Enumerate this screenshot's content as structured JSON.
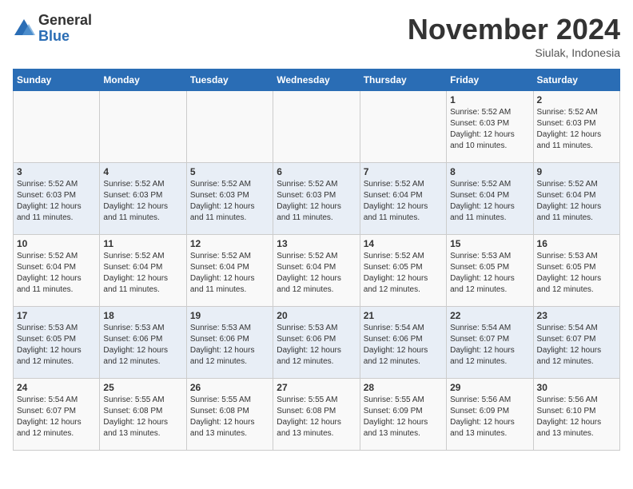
{
  "logo": {
    "general": "General",
    "blue": "Blue"
  },
  "header": {
    "month": "November 2024",
    "location": "Siulak, Indonesia"
  },
  "days_of_week": [
    "Sunday",
    "Monday",
    "Tuesday",
    "Wednesday",
    "Thursday",
    "Friday",
    "Saturday"
  ],
  "weeks": [
    [
      {
        "day": "",
        "info": ""
      },
      {
        "day": "",
        "info": ""
      },
      {
        "day": "",
        "info": ""
      },
      {
        "day": "",
        "info": ""
      },
      {
        "day": "",
        "info": ""
      },
      {
        "day": "1",
        "info": "Sunrise: 5:52 AM\nSunset: 6:03 PM\nDaylight: 12 hours\nand 10 minutes."
      },
      {
        "day": "2",
        "info": "Sunrise: 5:52 AM\nSunset: 6:03 PM\nDaylight: 12 hours\nand 11 minutes."
      }
    ],
    [
      {
        "day": "3",
        "info": "Sunrise: 5:52 AM\nSunset: 6:03 PM\nDaylight: 12 hours\nand 11 minutes."
      },
      {
        "day": "4",
        "info": "Sunrise: 5:52 AM\nSunset: 6:03 PM\nDaylight: 12 hours\nand 11 minutes."
      },
      {
        "day": "5",
        "info": "Sunrise: 5:52 AM\nSunset: 6:03 PM\nDaylight: 12 hours\nand 11 minutes."
      },
      {
        "day": "6",
        "info": "Sunrise: 5:52 AM\nSunset: 6:03 PM\nDaylight: 12 hours\nand 11 minutes."
      },
      {
        "day": "7",
        "info": "Sunrise: 5:52 AM\nSunset: 6:04 PM\nDaylight: 12 hours\nand 11 minutes."
      },
      {
        "day": "8",
        "info": "Sunrise: 5:52 AM\nSunset: 6:04 PM\nDaylight: 12 hours\nand 11 minutes."
      },
      {
        "day": "9",
        "info": "Sunrise: 5:52 AM\nSunset: 6:04 PM\nDaylight: 12 hours\nand 11 minutes."
      }
    ],
    [
      {
        "day": "10",
        "info": "Sunrise: 5:52 AM\nSunset: 6:04 PM\nDaylight: 12 hours\nand 11 minutes."
      },
      {
        "day": "11",
        "info": "Sunrise: 5:52 AM\nSunset: 6:04 PM\nDaylight: 12 hours\nand 11 minutes."
      },
      {
        "day": "12",
        "info": "Sunrise: 5:52 AM\nSunset: 6:04 PM\nDaylight: 12 hours\nand 11 minutes."
      },
      {
        "day": "13",
        "info": "Sunrise: 5:52 AM\nSunset: 6:04 PM\nDaylight: 12 hours\nand 12 minutes."
      },
      {
        "day": "14",
        "info": "Sunrise: 5:52 AM\nSunset: 6:05 PM\nDaylight: 12 hours\nand 12 minutes."
      },
      {
        "day": "15",
        "info": "Sunrise: 5:53 AM\nSunset: 6:05 PM\nDaylight: 12 hours\nand 12 minutes."
      },
      {
        "day": "16",
        "info": "Sunrise: 5:53 AM\nSunset: 6:05 PM\nDaylight: 12 hours\nand 12 minutes."
      }
    ],
    [
      {
        "day": "17",
        "info": "Sunrise: 5:53 AM\nSunset: 6:05 PM\nDaylight: 12 hours\nand 12 minutes."
      },
      {
        "day": "18",
        "info": "Sunrise: 5:53 AM\nSunset: 6:06 PM\nDaylight: 12 hours\nand 12 minutes."
      },
      {
        "day": "19",
        "info": "Sunrise: 5:53 AM\nSunset: 6:06 PM\nDaylight: 12 hours\nand 12 minutes."
      },
      {
        "day": "20",
        "info": "Sunrise: 5:53 AM\nSunset: 6:06 PM\nDaylight: 12 hours\nand 12 minutes."
      },
      {
        "day": "21",
        "info": "Sunrise: 5:54 AM\nSunset: 6:06 PM\nDaylight: 12 hours\nand 12 minutes."
      },
      {
        "day": "22",
        "info": "Sunrise: 5:54 AM\nSunset: 6:07 PM\nDaylight: 12 hours\nand 12 minutes."
      },
      {
        "day": "23",
        "info": "Sunrise: 5:54 AM\nSunset: 6:07 PM\nDaylight: 12 hours\nand 12 minutes."
      }
    ],
    [
      {
        "day": "24",
        "info": "Sunrise: 5:54 AM\nSunset: 6:07 PM\nDaylight: 12 hours\nand 12 minutes."
      },
      {
        "day": "25",
        "info": "Sunrise: 5:55 AM\nSunset: 6:08 PM\nDaylight: 12 hours\nand 13 minutes."
      },
      {
        "day": "26",
        "info": "Sunrise: 5:55 AM\nSunset: 6:08 PM\nDaylight: 12 hours\nand 13 minutes."
      },
      {
        "day": "27",
        "info": "Sunrise: 5:55 AM\nSunset: 6:08 PM\nDaylight: 12 hours\nand 13 minutes."
      },
      {
        "day": "28",
        "info": "Sunrise: 5:55 AM\nSunset: 6:09 PM\nDaylight: 12 hours\nand 13 minutes."
      },
      {
        "day": "29",
        "info": "Sunrise: 5:56 AM\nSunset: 6:09 PM\nDaylight: 12 hours\nand 13 minutes."
      },
      {
        "day": "30",
        "info": "Sunrise: 5:56 AM\nSunset: 6:10 PM\nDaylight: 12 hours\nand 13 minutes."
      }
    ]
  ]
}
